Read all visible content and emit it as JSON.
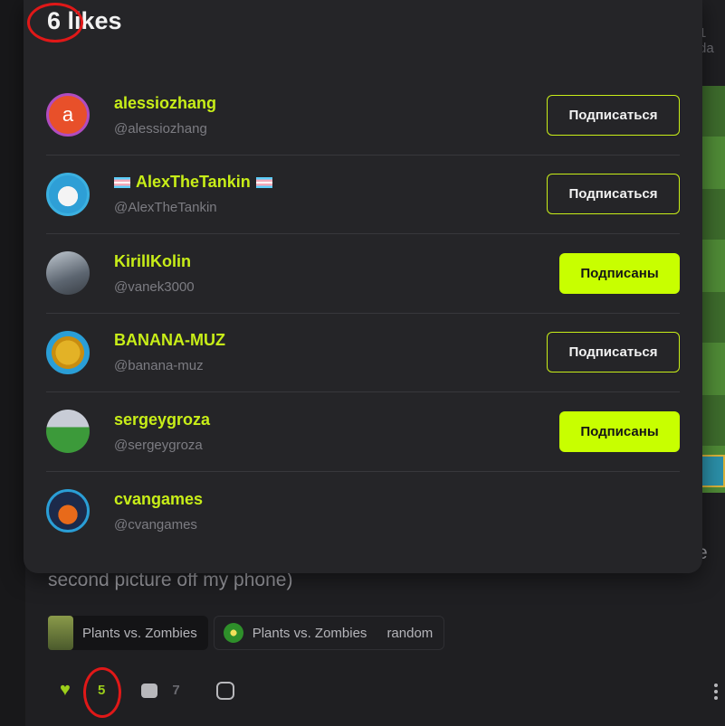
{
  "background": {
    "time_fragment": "1 da",
    "post_text_line1_end": "e",
    "post_text_line2": "second picture off my phone)",
    "tags": [
      {
        "label": "Plants vs. Zombies"
      },
      {
        "label": "Plants vs. Zombies"
      },
      {
        "label": "random"
      }
    ],
    "actions": {
      "like_count": "5",
      "comment_count": "7"
    }
  },
  "modal": {
    "title": "6 likes",
    "users": [
      {
        "name": "alessiozhang",
        "handle": "@alessiozhang",
        "button": "Подписаться",
        "state": "follow",
        "avatar_letter": "a"
      },
      {
        "name": "AlexTheTankin",
        "handle": "@AlexTheTankin",
        "button": "Подписаться",
        "state": "follow",
        "flags": true
      },
      {
        "name": "KirillKolin",
        "handle": "@vanek3000",
        "button": "Подписаны",
        "state": "following"
      },
      {
        "name": "BANANA-MUZ",
        "handle": "@banana-muz",
        "button": "Подписаться",
        "state": "follow"
      },
      {
        "name": "sergeygroza",
        "handle": "@sergeygroza",
        "button": "Подписаны",
        "state": "following"
      },
      {
        "name": "cvangames",
        "handle": "@cvangames",
        "button": "",
        "state": "self"
      }
    ]
  },
  "colors": {
    "accent": "#c8ff00",
    "name": "#c8ee18",
    "annotation": "#e01818"
  }
}
